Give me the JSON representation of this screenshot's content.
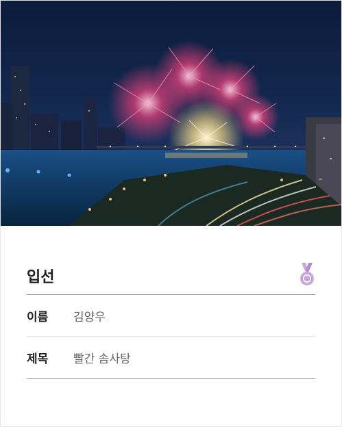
{
  "award": {
    "title": "입선",
    "medal_icon": "medal-icon",
    "medal_color": "#c9a6db"
  },
  "info": [
    {
      "label": "이름",
      "value": "김양우"
    },
    {
      "label": "제목",
      "value": "빨간 솜사탕"
    }
  ],
  "photo": {
    "subject": "fireworks-night-city-photo",
    "colors": {
      "sky": "#13284f",
      "firework_pink": "#e0407a",
      "firework_gold": "#ffe08a",
      "water": "#0b3a63"
    }
  }
}
